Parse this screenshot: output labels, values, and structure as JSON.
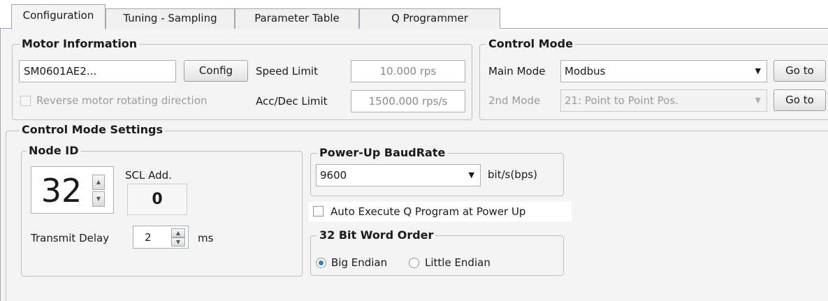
{
  "tabs": [
    "Configuration",
    "Tuning - Sampling",
    "Parameter Table",
    "Q Programmer"
  ],
  "motor_info": {
    "title": "Motor Information",
    "motor_model": "SM0601AE2...",
    "config_button": "Config",
    "speed_limit_label": "Speed Limit",
    "speed_limit_value": "10.000 rps",
    "acc_dec_label": "Acc/Dec Limit",
    "acc_dec_value": "1500.000 rps/s",
    "reverse_label": "Reverse motor rotating direction",
    "reverse_checked": false
  },
  "control_mode": {
    "title": "Control Mode",
    "main_mode_label": "Main Mode",
    "main_mode_value": "Modbus",
    "second_mode_label": "2nd Mode",
    "second_mode_value": "21: Point to Point Pos.",
    "goto_label": "Go to"
  },
  "settings": {
    "title": "Control Mode Settings",
    "node_id": {
      "title": "Node ID",
      "value": "32",
      "scl_label": "SCL Add.",
      "scl_value": "0",
      "transmit_delay_label": "Transmit Delay",
      "transmit_delay_value": "2",
      "transmit_delay_unit": "ms"
    },
    "baud": {
      "title": "Power-Up BaudRate",
      "value": "9600",
      "unit": "bit/s(bps)"
    },
    "auto_execute_label": "Auto Execute Q Program at Power Up",
    "auto_execute_checked": false,
    "word_order": {
      "title": "32 Bit Word Order",
      "options": [
        "Big Endian",
        "Little Endian"
      ],
      "selected": "Big Endian"
    }
  }
}
